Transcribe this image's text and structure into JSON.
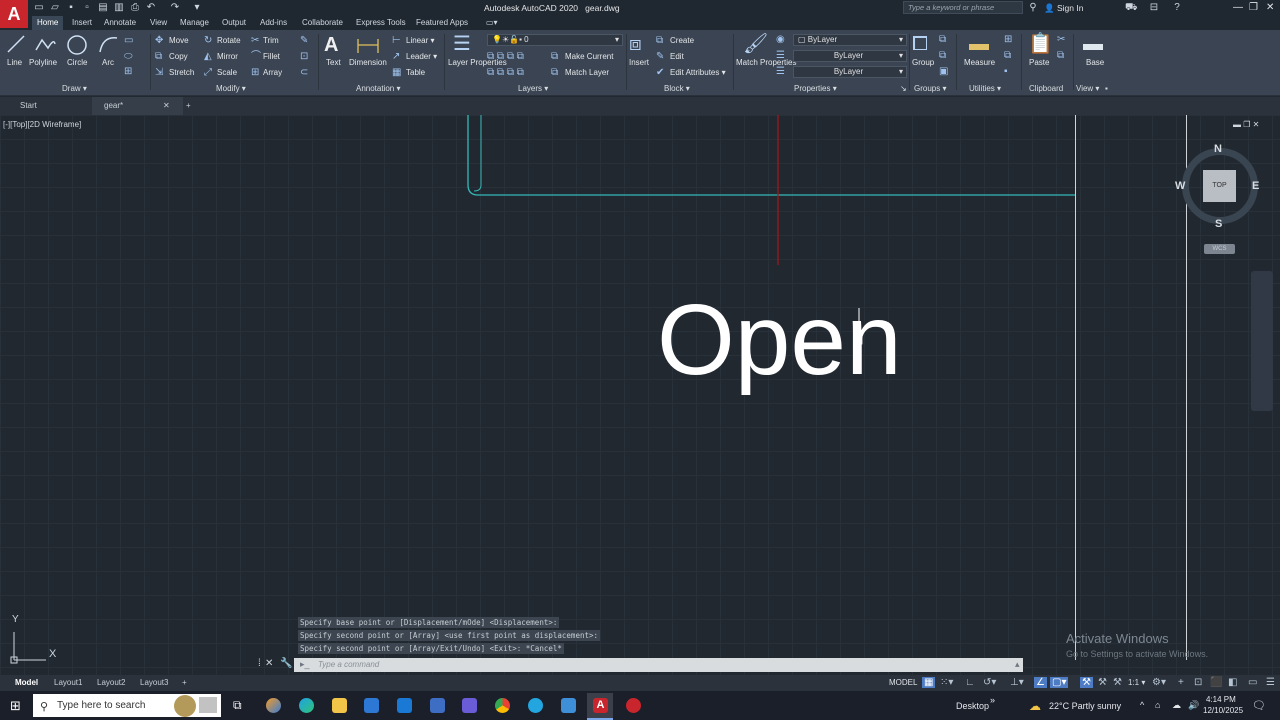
{
  "app": {
    "logo": "A",
    "title": "Autodesk AutoCAD 2020",
    "file": "gear.dwg",
    "search_placeholder": "Type a keyword or phrase",
    "sign_in": "Sign In"
  },
  "ribbon_tabs": [
    "Home",
    "Insert",
    "Annotate",
    "View",
    "Manage",
    "Output",
    "Add-ins",
    "Collaborate",
    "Express Tools",
    "Featured Apps"
  ],
  "draw": {
    "panel": "Draw",
    "line": "Line",
    "polyline": "Polyline",
    "circle": "Circle",
    "arc": "Arc"
  },
  "modify": {
    "panel": "Modify",
    "move": "Move",
    "rotate": "Rotate",
    "trim": "Trim",
    "copy": "Copy",
    "mirror": "Mirror",
    "fillet": "Fillet",
    "stretch": "Stretch",
    "scale": "Scale",
    "array": "Array"
  },
  "annotation": {
    "panel": "Annotation",
    "text": "Text",
    "dimension": "Dimension",
    "linear": "Linear",
    "leader": "Leader",
    "table": "Table"
  },
  "layers": {
    "panel": "Layers",
    "layer_properties": "Layer Properties",
    "current_layer": "0",
    "make_current": "Make Current",
    "match_layer": "Match Layer"
  },
  "block": {
    "panel": "Block",
    "insert": "Insert",
    "create": "Create",
    "edit": "Edit",
    "edit_attributes": "Edit Attributes"
  },
  "properties": {
    "panel": "Properties",
    "match_properties": "Match Properties",
    "color": "ByLayer",
    "linetype": "ByLayer",
    "lineweight": "ByLayer"
  },
  "groups": {
    "panel": "Groups",
    "group": "Group"
  },
  "utilities": {
    "panel": "Utilities",
    "measure": "Measure"
  },
  "clipboard": {
    "panel": "Clipboard",
    "paste": "Paste"
  },
  "view_panel": {
    "panel": "View",
    "base": "Base"
  },
  "file_tabs": {
    "start": "Start",
    "drawing": "gear*"
  },
  "viewport": {
    "label": "[-][Top][2D Wireframe]",
    "big_text": "Open"
  },
  "viewcube": {
    "n": "N",
    "s": "S",
    "e": "E",
    "w": "W",
    "top": "TOP",
    "wcs": "WCS"
  },
  "ucs": {
    "y": "Y",
    "x": "X"
  },
  "command": {
    "history": [
      "Specify base point or [Displacement/mOde] <Displacement>:",
      "Specify second point or [Array] <use first point as displacement>:",
      "Specify second point or [Array/Exit/Undo] <Exit>: *Cancel*"
    ],
    "placeholder": "Type a command"
  },
  "watermark": {
    "line1": "Activate Windows",
    "line2": "Go to Settings to activate Windows."
  },
  "layout_tabs": [
    "Model",
    "Layout1",
    "Layout2",
    "Layout3"
  ],
  "status": {
    "model": "MODEL",
    "scale": "1:1"
  },
  "taskbar": {
    "search": "Type here to search",
    "desktop": "Desktop",
    "weather": "22°C  Partly sunny",
    "time": "4:14 PM",
    "date": "12/10/2025"
  },
  "colors": {
    "accent_red": "#c8252c",
    "canvas": "#212830",
    "cyan_line": "#35b8b8",
    "red_axis": "#9b1a1a"
  }
}
